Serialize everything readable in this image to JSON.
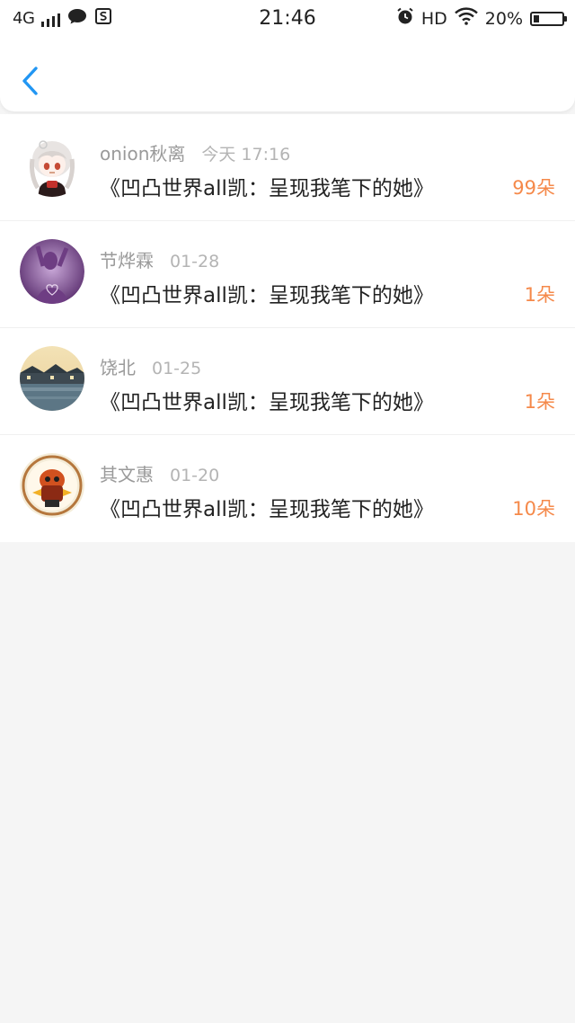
{
  "status_bar": {
    "network": "4G",
    "time": "21:46",
    "hd": "HD",
    "battery": "20%",
    "battery_level": 0.2,
    "icons": [
      "message-icon",
      "s-app-icon",
      "alarm-icon",
      "wifi-icon",
      "battery-icon"
    ]
  },
  "header": {
    "back_icon": "chevron-left-icon",
    "accent": "#2196f3"
  },
  "colors": {
    "count": "#f5894a",
    "meta": "#a6a6a6",
    "title": "#222222",
    "background": "#f5f5f5"
  },
  "items": [
    {
      "name": "onion秋离",
      "time": "今天 17:16",
      "title": "《凹凸世界all凯：呈现我笔下的她》",
      "count": "99朵",
      "avatar": "avatar-anime-girl"
    },
    {
      "name": "节烨霖",
      "time": "01-28",
      "title": "《凹凸世界all凯：呈现我笔下的她》",
      "count": "1朵",
      "avatar": "avatar-purple-silhouette"
    },
    {
      "name": "饶北",
      "time": "01-25",
      "title": "《凹凸世界all凯：呈现我笔下的她》",
      "count": "1朵",
      "avatar": "avatar-water-town"
    },
    {
      "name": "其文惠",
      "time": "01-20",
      "title": "《凹凸世界all凯：呈现我笔下的她》",
      "count": "10朵",
      "avatar": "avatar-cartoon-character"
    }
  ]
}
